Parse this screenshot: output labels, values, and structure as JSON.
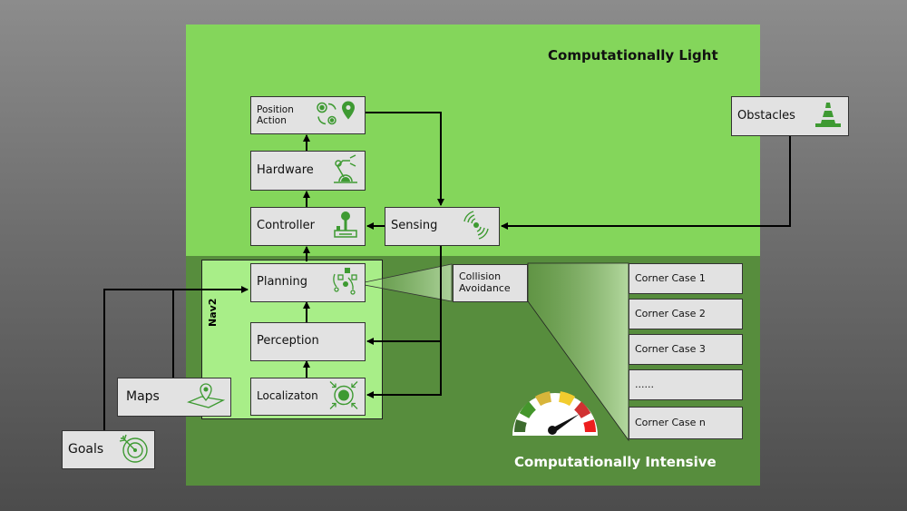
{
  "zones": {
    "light_title": "Computationally Light",
    "intensive_title": "Computationally Intensive"
  },
  "nav2_label": "Nav2",
  "nodes": {
    "position_action": "Position\nAction",
    "hardware": "Hardware",
    "controller": "Controller",
    "sensing": "Sensing",
    "obstacles": "Obstacles",
    "planning": "Planning",
    "perception": "Perception",
    "localization": "Localizaton",
    "maps": "Maps",
    "goals": "Goals",
    "collision_avoidance": "Collision\nAvoidance"
  },
  "corner_cases": [
    "Corner Case 1",
    "Corner Case 2",
    "Corner Case 3",
    "......",
    "Corner Case n"
  ],
  "icons": {
    "position_action": "gears-to-location-pin-icon",
    "hardware": "robot-arm-icon",
    "controller": "joystick-icon",
    "sensing": "signal-waves-icon",
    "obstacles": "traffic-cone-icon",
    "planning": "path-planning-icon",
    "localization": "target-focus-icon",
    "maps": "map-pin-icon",
    "goals": "target-arrow-icon",
    "gauge": "speedometer-gauge-icon"
  },
  "colors": {
    "light_zone": "#84d65b",
    "intensive_zone": "#578d3d",
    "nav2_zone": "#a8ee88",
    "box_fill": "#e2e2e2",
    "icon_green": "#3e9a32"
  }
}
